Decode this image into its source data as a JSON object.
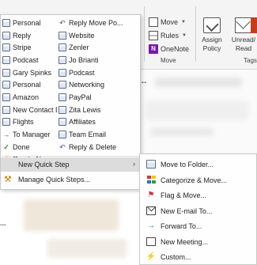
{
  "ribbon": {
    "move_label": "Move",
    "rules_label": "Rules",
    "onenote_label": "OneNote",
    "onenote_glyph": "N",
    "move_group_label": "Move",
    "assign_policy_label": "Assign Policy",
    "unread_read_label": "Unread/ Read",
    "tags_group_label": "Tags"
  },
  "background": {
    "partial_text_1": "...",
    "partial_text_2": "..."
  },
  "quick_steps": {
    "left": [
      {
        "label": "Personal",
        "icon": "folder-icon"
      },
      {
        "label": "Reply",
        "icon": "folder-icon"
      },
      {
        "label": "Stripe",
        "icon": "folder-icon"
      },
      {
        "label": "Podcast",
        "icon": "folder-icon"
      },
      {
        "label": "Gary Spinks",
        "icon": "folder-icon"
      },
      {
        "label": "Personal",
        "icon": "folder-icon"
      },
      {
        "label": "Amazon",
        "icon": "folder-icon"
      },
      {
        "label": "New Contact D...",
        "icon": "folder-icon"
      },
      {
        "label": "Flights",
        "icon": "folder-icon"
      },
      {
        "label": "To Manager",
        "icon": "arrow-right-icon"
      },
      {
        "label": "Done",
        "icon": "checkmark-icon"
      },
      {
        "label": "Create New",
        "icon": "lightning-icon"
      }
    ],
    "right": [
      {
        "label": "Reply Move Po...",
        "icon": "reply-icon"
      },
      {
        "label": "Website",
        "icon": "folder-icon"
      },
      {
        "label": "Zenler",
        "icon": "folder-icon"
      },
      {
        "label": "Jo Brianti",
        "icon": "folder-icon"
      },
      {
        "label": "Podcast",
        "icon": "folder-icon"
      },
      {
        "label": "Networking",
        "icon": "folder-icon"
      },
      {
        "label": "PayPal",
        "icon": "folder-icon"
      },
      {
        "label": "Zita Lewis",
        "icon": "folder-icon"
      },
      {
        "label": "Affiliates",
        "icon": "folder-icon"
      },
      {
        "label": "Team Email",
        "icon": "folder-icon"
      },
      {
        "label": "Reply & Delete",
        "icon": "reply-icon"
      }
    ]
  },
  "menu": {
    "new_quick_step_label": "New Quick Step",
    "manage_quick_steps_label": "Manage Quick Steps..."
  },
  "submenu": {
    "items": [
      {
        "label": "Move to Folder...",
        "icon": "move-folder-icon"
      },
      {
        "label": "Categorize & Move...",
        "icon": "categorize-icon"
      },
      {
        "label": "Flag & Move...",
        "icon": "flag-icon"
      },
      {
        "label": "New E-mail To...",
        "icon": "new-email-icon"
      },
      {
        "label": "Forward To...",
        "icon": "forward-icon"
      },
      {
        "label": "New Meeting...",
        "icon": "meeting-icon"
      },
      {
        "label": "Custom...",
        "icon": "custom-icon"
      }
    ]
  },
  "colors": {
    "highlight": "#dcdcdc",
    "menu_border": "#c9c9c9",
    "reply_purple": "#6b3fa0",
    "flag_red": "#d13438",
    "bolt_yellow": "#e6a800",
    "onenote_purple": "#7719aa"
  }
}
